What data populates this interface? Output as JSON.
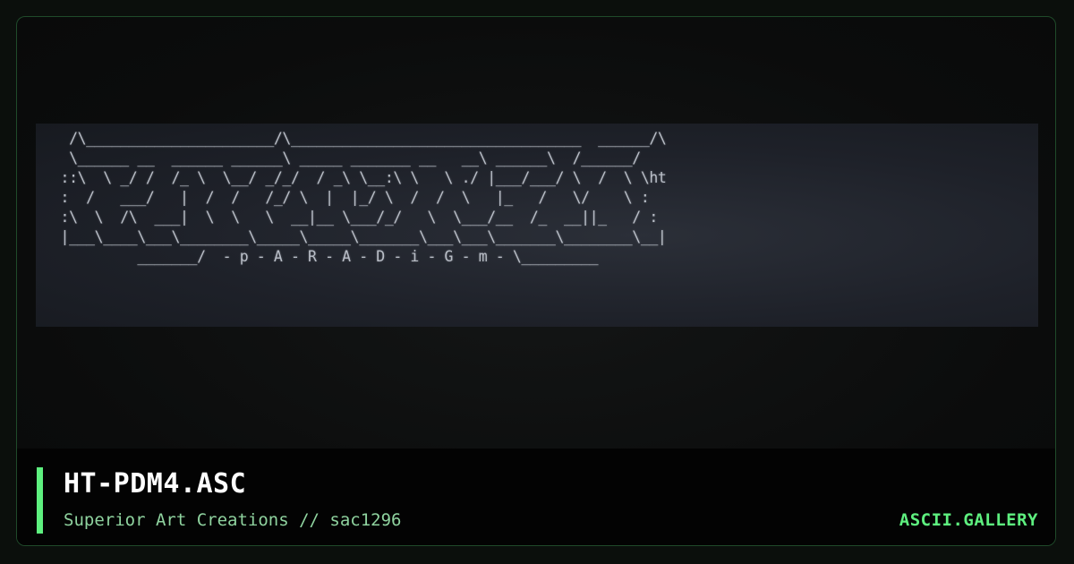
{
  "colors": {
    "accent": "#5ef07f",
    "border": "#1f4a2a",
    "background": "#0b0f0c",
    "footer_background": "#030303",
    "title": "#ffffff",
    "subtitle": "#8fd39f"
  },
  "artwork": {
    "ascii": "  /\\______________________/\\__________________________________  ______/\\\n  \\______ __  ______ ______\\ _____ _______ __   __\\ ______\\  /______/\n ::\\  \\ _/ /  /_ \\  \\__/ _/_/  / _\\ \\__:\\ \\   \\ ./ |___/___/ \\  /  \\ \\ht\n :  /   ___/   |  /  /   /_/ \\  |  |_/ \\  /  /  \\   |_   /   \\/    \\ :\n :\\  \\  /\\  ___|  \\  \\   \\  __|__ \\___/_/   \\  \\___/__  /_  __||_   / :\n |___\\____\\___\\________\\_____\\_____\\_______\\___\\___\\_______\\________\\__|\n          _______/  - p - A - R - A - D - i - G - m - \\_________"
  },
  "footer": {
    "title": "HT-PDM4.ASC",
    "subtitle": "Superior Art Creations // sac1296",
    "brand": "ASCII.GALLERY"
  }
}
